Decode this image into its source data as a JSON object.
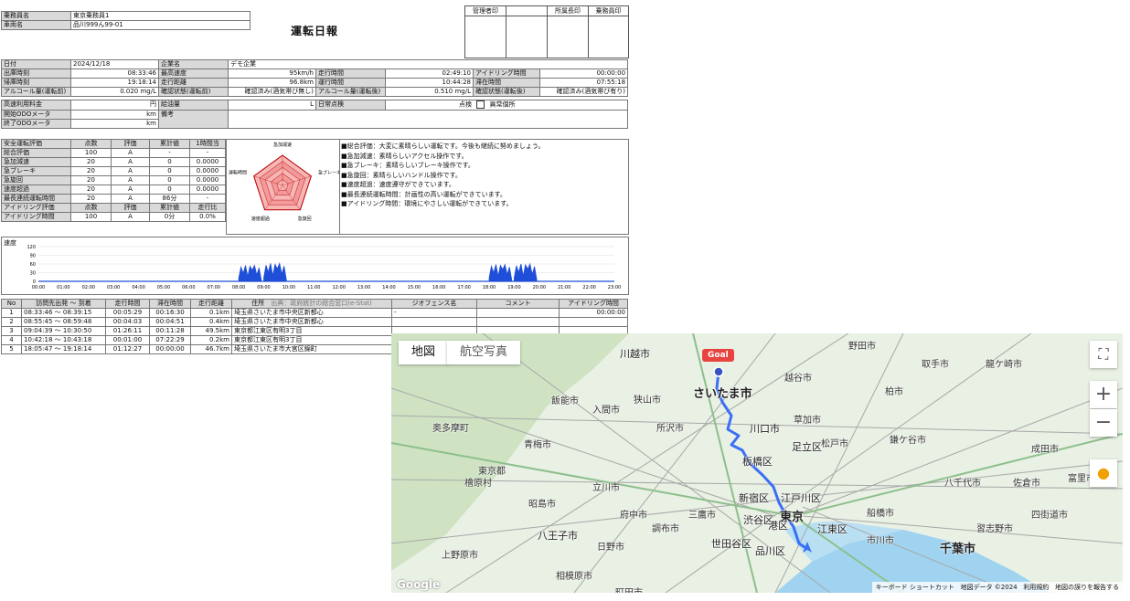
{
  "header": {
    "driver_label": "乗務員名",
    "driver_value": "東京乗務員1",
    "vehicle_label": "車両名",
    "vehicle_value": "品川999ん99-01",
    "title": "運転日報"
  },
  "stamps": [
    "管理者印",
    "",
    "所属長印",
    "乗務員印"
  ],
  "info": {
    "rows": [
      [
        "日付",
        "2024/12/18",
        "企業名",
        "デモ企業",
        "",
        "",
        "",
        ""
      ],
      [
        "出庫時刻",
        "08:33:46",
        "最高速度",
        "95km/h",
        "走行時間",
        "02:49:10",
        "アイドリング時間",
        "00:00:00"
      ],
      [
        "帰庫時刻",
        "19:18:14",
        "走行距離",
        "96.8km",
        "運行時間",
        "10:44:28",
        "滞在時間",
        "07:55:18"
      ],
      [
        "アルコール量(運転前)",
        "0.020 mg/L",
        "確認状態(運転前)",
        "確認済み(酒気帯び無し)",
        "アルコール量(運転後)",
        "0.510 mg/L",
        "確認状態(運転後)",
        "確認済み(酒気帯び有り)"
      ]
    ],
    "toll_label": "高速利用料金",
    "toll_unit": "円",
    "fuel_label": "給油量",
    "fuel_unit": "L",
    "daily_check_label": "日常点検",
    "check_ok": "点検",
    "check_ng": "異常個所",
    "odo_start_label": "開始ODOメータ",
    "odo_end_label": "終了ODOメータ",
    "odo_unit": "km",
    "remarks_label": "備考"
  },
  "safety": {
    "headers": [
      "安全運転評価",
      "点数",
      "評価",
      "累計値",
      "1時間当"
    ],
    "rows": [
      [
        "総合評価",
        "100",
        "A",
        "-",
        "-"
      ],
      [
        "急加減速",
        "20",
        "A",
        "0",
        "0.0000"
      ],
      [
        "急ブレーキ",
        "20",
        "A",
        "0",
        "0.0000"
      ],
      [
        "急旋回",
        "20",
        "A",
        "0",
        "0.0000"
      ],
      [
        "速度超過",
        "20",
        "A",
        "0",
        "0.0000"
      ],
      [
        "最長連続運転時間",
        "20",
        "A",
        "86分",
        "-"
      ]
    ],
    "idle_headers": [
      "アイドリング評価",
      "点数",
      "評価",
      "累計値",
      "走行比"
    ],
    "idle_row": [
      "アイドリング時間",
      "100",
      "A",
      "0分",
      "0.0%"
    ]
  },
  "radar": {
    "labels": [
      "急加減速",
      "急ブレーキ",
      "急旋回",
      "速度超過",
      "運転時間"
    ],
    "values": [
      1,
      1,
      1,
      1,
      1
    ]
  },
  "comments": [
    "■総合評価：大変に素晴らしい運転です。今後も継続に努めましょう。",
    "■急加減速：素晴らしいアクセル操作です。",
    "■急ブレーキ：素晴らしいブレーキ操作です。",
    "■急旋回：素晴らしいハンドル操作です。",
    "■速度超過：速度遵守ができています。",
    "■最長連続運転時間：計画性の高い運転ができています。",
    "■アイドリング時間：環境にやさしい運転ができています。"
  ],
  "chart_data": {
    "type": "area",
    "title": "速度",
    "x": [
      "00:00",
      "01:00",
      "02:00",
      "03:00",
      "04:00",
      "05:00",
      "06:00",
      "07:00",
      "08:00",
      "09:00",
      "10:00",
      "11:00",
      "12:00",
      "13:00",
      "14:00",
      "15:00",
      "16:00",
      "17:00",
      "18:00",
      "19:00",
      "20:00",
      "21:00",
      "22:00",
      "23:00"
    ],
    "yticks": [
      0,
      30,
      60,
      90,
      120
    ],
    "ylim": [
      0,
      120
    ],
    "series": [
      {
        "values_by_hour": [
          0,
          0,
          0,
          0,
          0,
          0,
          0,
          0,
          55,
          62,
          0,
          0,
          0,
          0,
          0,
          0,
          0,
          0,
          58,
          60,
          0,
          0,
          0,
          0
        ]
      }
    ],
    "color": "#1f4fd8"
  },
  "visits": {
    "headers": [
      "No",
      "訪問先出発 ～ 到着",
      "走行時間",
      "滞在時間",
      "走行距離",
      "住所",
      "出典：政府統計の総合窓口(e-Stat)",
      "ジオフェンス名",
      "コメント",
      "アイドリング時間"
    ],
    "rows": [
      [
        "1",
        "08:33:46 ～ 08:39:15",
        "00:05:29",
        "00:16:30",
        "0.1km",
        "埼玉県さいたま市中央区新都心",
        "-",
        "",
        "00:00:00"
      ],
      [
        "2",
        "08:55:45 ～ 08:59:48",
        "00:04:03",
        "00:04:51",
        "0.4km",
        "埼玉県さいたま市中央区新都心",
        "",
        "",
        ""
      ],
      [
        "3",
        "09:04:39 ～ 10:30:50",
        "01:26:11",
        "00:11:28",
        "49.5km",
        "東京都江東区有明3丁目",
        "",
        "",
        ""
      ],
      [
        "4",
        "10:42:18 ～ 10:43:18",
        "00:01:00",
        "07:22:29",
        "0.2km",
        "東京都江東区有明3丁目",
        "",
        "",
        ""
      ],
      [
        "5",
        "18:05:47 ～ 19:18:14",
        "01:12:27",
        "00:00:00",
        "46.7km",
        "埼玉県さいたま市大宮区錦町",
        "",
        "",
        ""
      ]
    ]
  },
  "map": {
    "tab_map": "地図",
    "tab_satellite": "航空写真",
    "goal": "Goal",
    "footer": [
      "キーボード ショートカット",
      "地図データ ©2024",
      "利用規約",
      "地図の誤りを報告する"
    ],
    "google": "Google",
    "labels": [
      "川越市",
      "さいたま市",
      "越谷市",
      "野田市",
      "柏市",
      "取手市",
      "龍ケ崎市",
      "川口市",
      "草加市",
      "足立区",
      "松戸市",
      "鎌ケ谷市",
      "板橋区",
      "新宿区",
      "江戸川区",
      "東京",
      "渋谷区",
      "港区",
      "江東区",
      "世田谷区",
      "品川区",
      "船橋市",
      "八千代市",
      "成田市",
      "千葉市",
      "東京都",
      "八王子市",
      "立川市",
      "府中市",
      "調布市",
      "三鷹市",
      "相模原市",
      "町田市",
      "所沢市",
      "入間市",
      "飯能市",
      "青梅市",
      "奥多摩町",
      "檜原村",
      "昭島市",
      "日野市",
      "上野原市",
      "狭山市",
      "佐倉市",
      "富里市",
      "習志野市",
      "市川市",
      "四街道市"
    ]
  }
}
